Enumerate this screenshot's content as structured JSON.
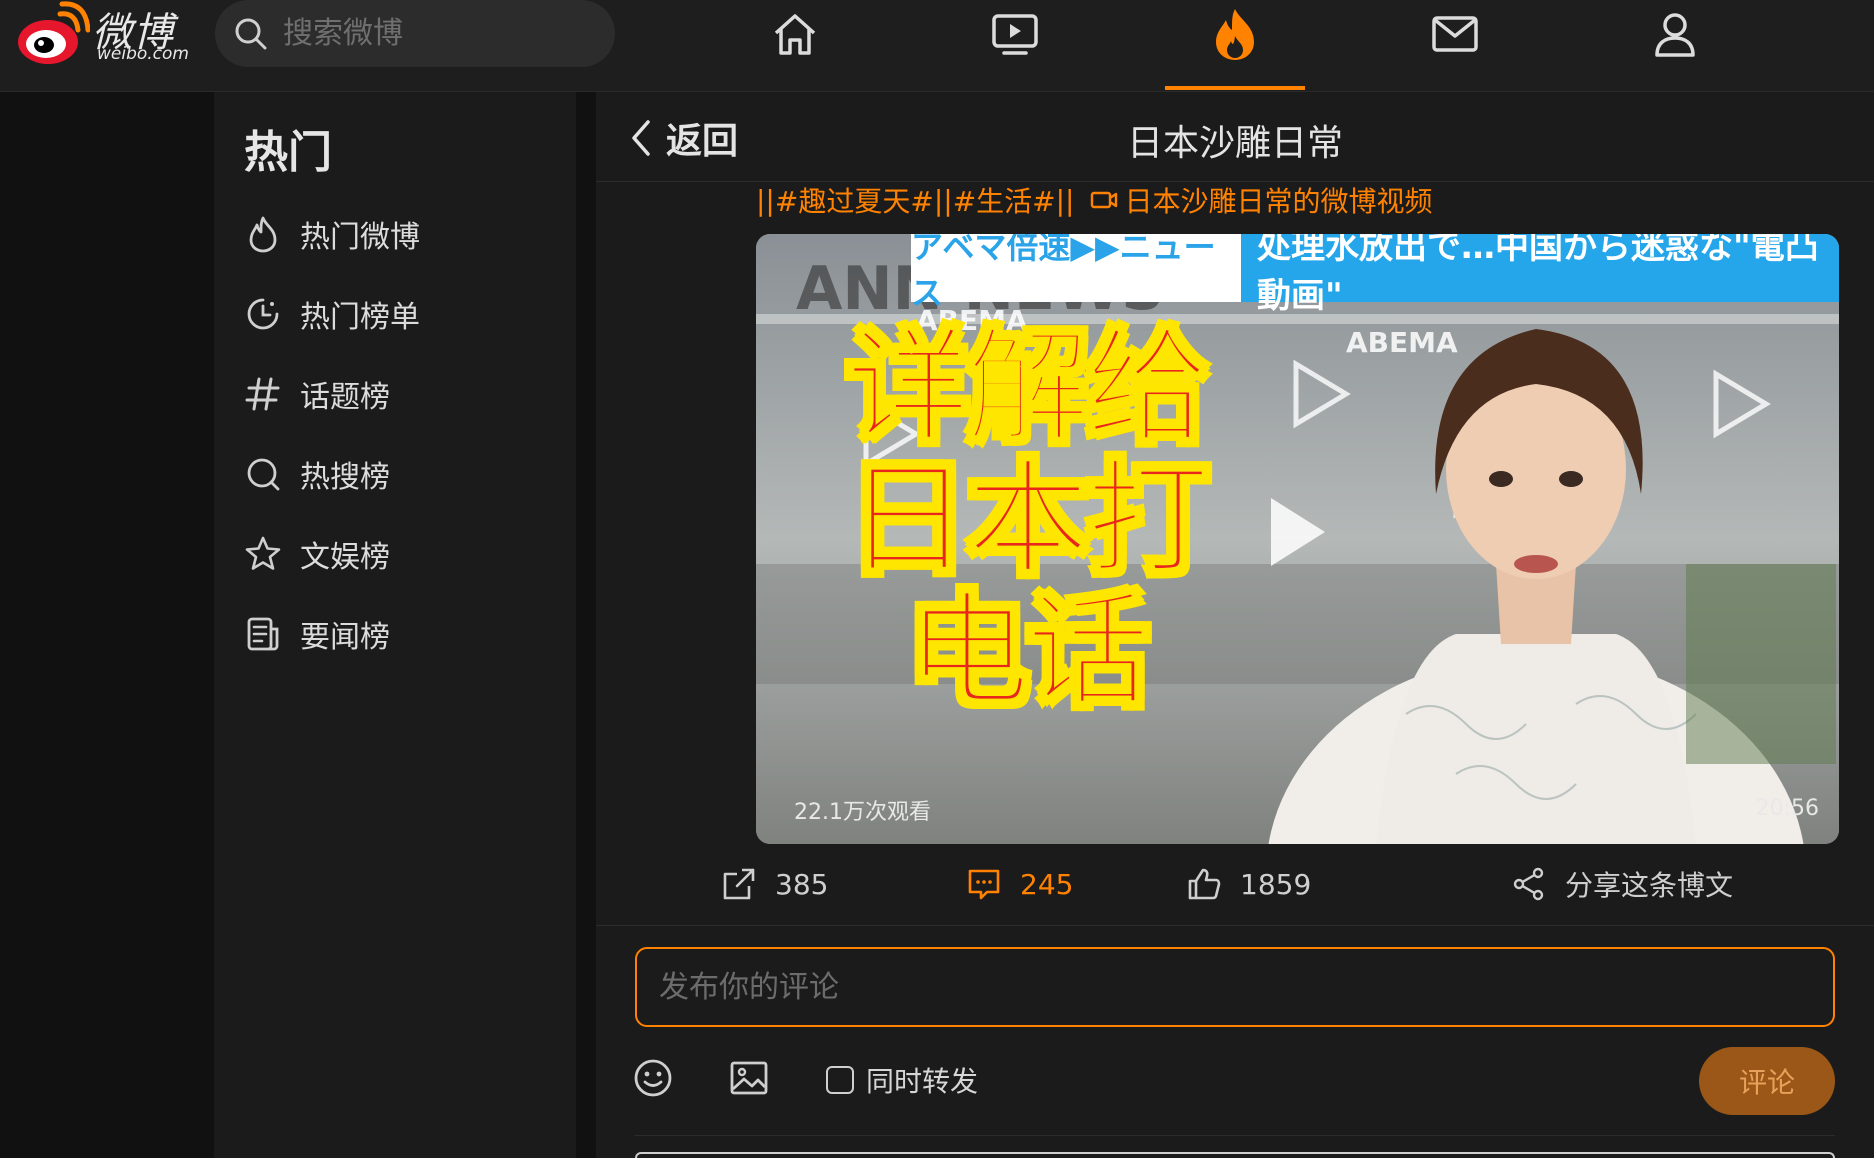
{
  "brand": {
    "name": "微博",
    "domain": "weibo.com"
  },
  "search": {
    "placeholder": "搜索微博"
  },
  "topnav": {
    "items": [
      {
        "icon": "home-icon"
      },
      {
        "icon": "video-icon"
      },
      {
        "icon": "hot-icon",
        "active": true
      },
      {
        "icon": "mail-icon"
      },
      {
        "icon": "profile-icon"
      }
    ],
    "accent": "#ff8200"
  },
  "sidebar": {
    "title": "热门",
    "items": [
      {
        "icon": "flame-icon",
        "label": "热门微博"
      },
      {
        "icon": "clock-icon",
        "label": "热门榜单"
      },
      {
        "icon": "hashtag-icon",
        "label": "话题榜"
      },
      {
        "icon": "search-icon",
        "label": "热搜榜"
      },
      {
        "icon": "star-icon",
        "label": "文娱榜"
      },
      {
        "icon": "news-icon",
        "label": "要闻榜"
      }
    ]
  },
  "main": {
    "back_label": "返回",
    "title": "日本沙雕日常",
    "tags": {
      "sep1": "||",
      "tag1": "#趣过夏天#",
      "sep2": "||",
      "tag2": "#生活#",
      "sep3": "||",
      "video_link": "日本沙雕日常的微博视频"
    },
    "video": {
      "caption_left": "アベマ倍速▶▶ニュース",
      "caption_right": "处理水放出で…中国から迷惑な\"電凸動画\"",
      "overlay_text": "详解给日本打电话",
      "views": "22.1万次观看",
      "duration": "20:56",
      "watermark": "ANN NEWS",
      "brand_tag": "ABEMA"
    },
    "actions": {
      "repost_count": "385",
      "comment_count": "245",
      "like_count": "1859",
      "share_label": "分享这条博文"
    },
    "comment_box": {
      "placeholder": "发布你的评论",
      "repost_label": "同时转发",
      "submit_label": "评论"
    }
  }
}
